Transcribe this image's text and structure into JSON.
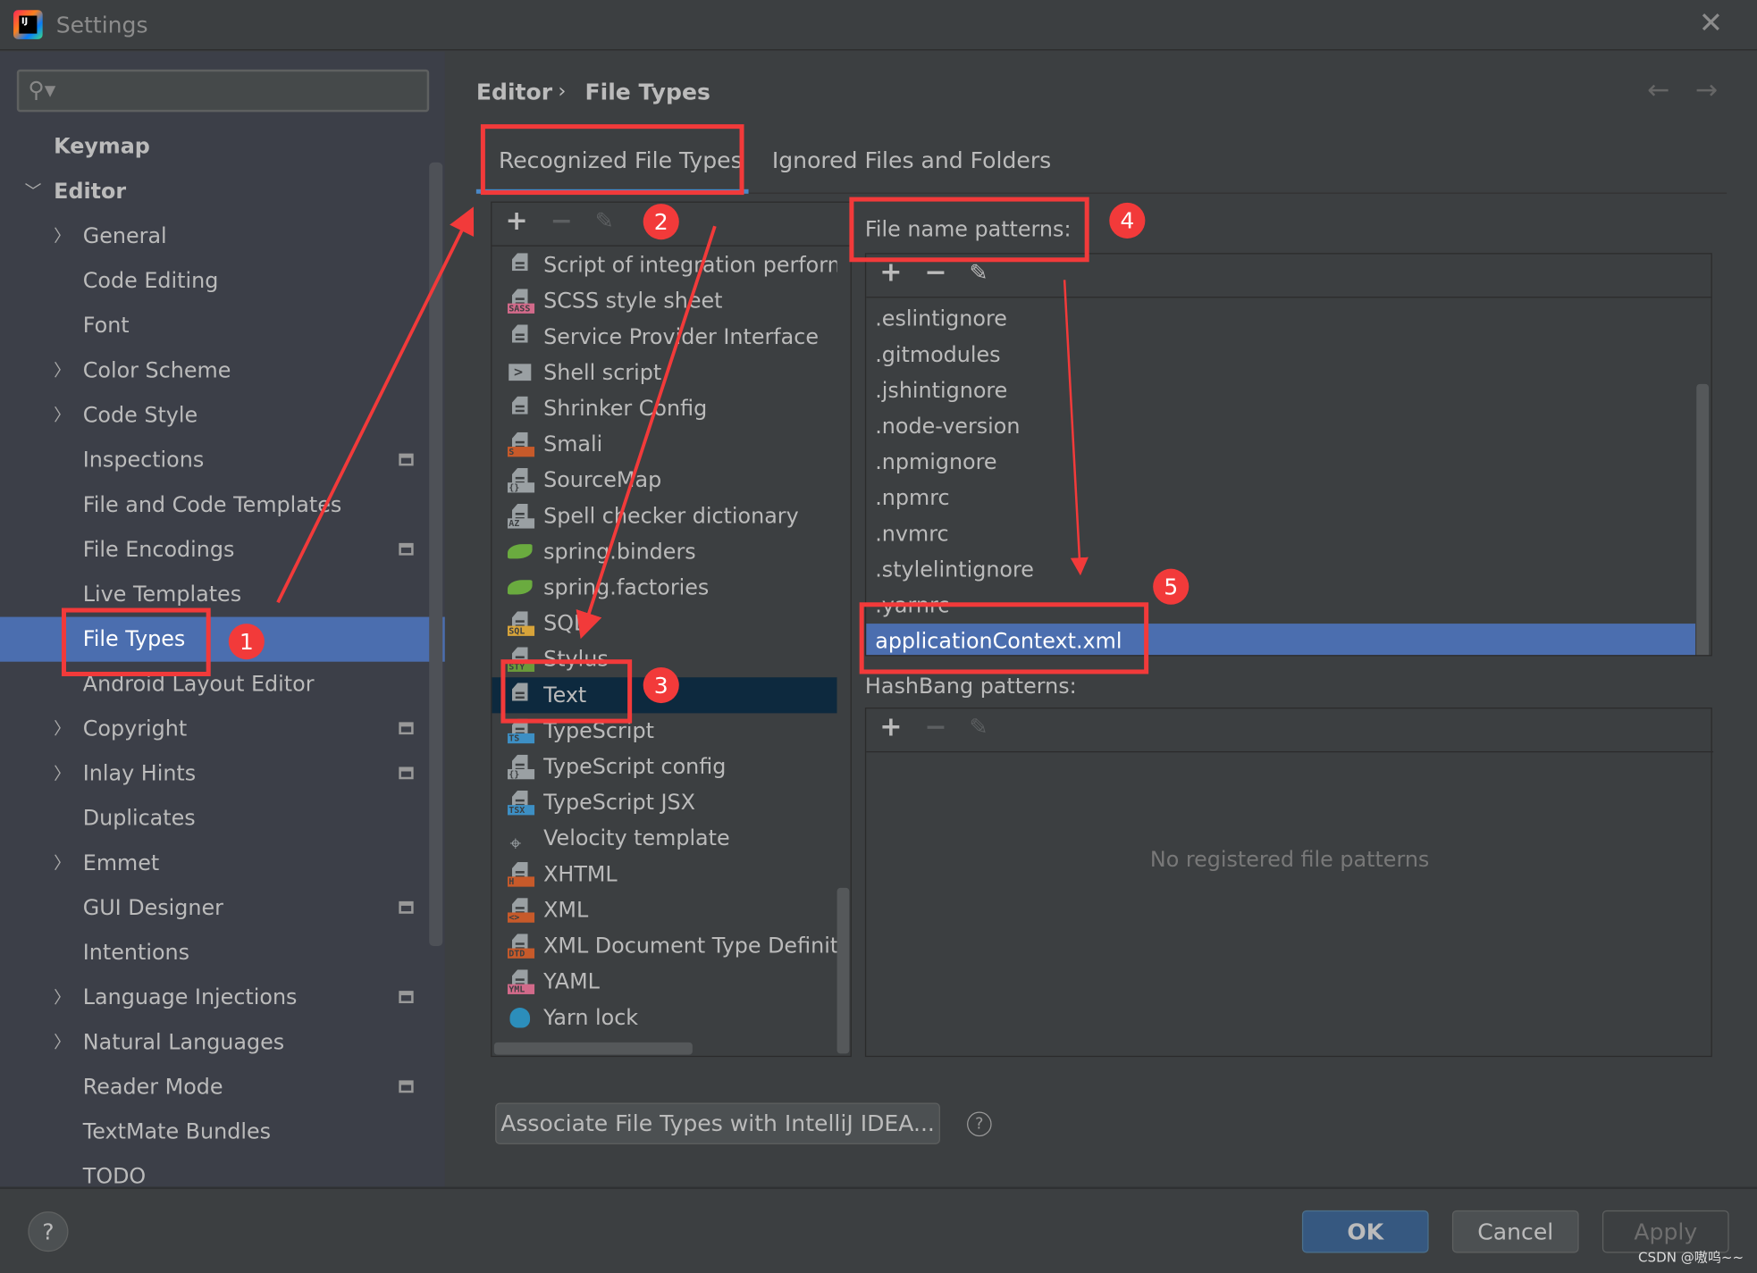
{
  "window": {
    "title": "Settings",
    "close_icon": "close-icon"
  },
  "search": {
    "placeholder": "",
    "icon": "search-icon"
  },
  "sidebar": {
    "items": [
      {
        "label": "Keymap",
        "level": 0,
        "bold": true
      },
      {
        "label": "Editor",
        "level": 0,
        "bold": true,
        "expanded": true
      },
      {
        "label": "General",
        "level": 1,
        "chevron": true
      },
      {
        "label": "Code Editing",
        "level": 1
      },
      {
        "label": "Font",
        "level": 1
      },
      {
        "label": "Color Scheme",
        "level": 1,
        "chevron": true
      },
      {
        "label": "Code Style",
        "level": 1,
        "chevron": true
      },
      {
        "label": "Inspections",
        "level": 1,
        "project": true
      },
      {
        "label": "File and Code Templates",
        "level": 1
      },
      {
        "label": "File Encodings",
        "level": 1,
        "project": true
      },
      {
        "label": "Live Templates",
        "level": 1
      },
      {
        "label": "File Types",
        "level": 1,
        "selected": true
      },
      {
        "label": "Android Layout Editor",
        "level": 1
      },
      {
        "label": "Copyright",
        "level": 1,
        "chevron": true,
        "project": true
      },
      {
        "label": "Inlay Hints",
        "level": 1,
        "chevron": true,
        "project": true
      },
      {
        "label": "Duplicates",
        "level": 1
      },
      {
        "label": "Emmet",
        "level": 1,
        "chevron": true
      },
      {
        "label": "GUI Designer",
        "level": 1,
        "project": true
      },
      {
        "label": "Intentions",
        "level": 1
      },
      {
        "label": "Language Injections",
        "level": 1,
        "chevron": true,
        "project": true
      },
      {
        "label": "Natural Languages",
        "level": 1,
        "chevron": true
      },
      {
        "label": "Reader Mode",
        "level": 1,
        "project": true
      },
      {
        "label": "TextMate Bundles",
        "level": 1
      },
      {
        "label": "TODO",
        "level": 1
      }
    ]
  },
  "breadcrumb": {
    "parent": "Editor",
    "separator": "›",
    "current": "File Types"
  },
  "tabs": [
    {
      "label": "Recognized File Types",
      "active": true
    },
    {
      "label": "Ignored Files and Folders"
    }
  ],
  "file_types": [
    {
      "label": "Script of integration performance",
      "icon": "text-file-icon"
    },
    {
      "label": "SCSS style sheet",
      "icon": "scss-file-icon",
      "badge": "SASS",
      "color": "#d26a8a"
    },
    {
      "label": "Service Provider Interface",
      "icon": "text-file-icon"
    },
    {
      "label": "Shell script",
      "icon": "shell-icon"
    },
    {
      "label": "Shrinker Config",
      "icon": "text-file-icon"
    },
    {
      "label": "Smali",
      "icon": "smali-file-icon",
      "badge": "S",
      "color": "#c75a2a"
    },
    {
      "label": "SourceMap",
      "icon": "sourcemap-file-icon",
      "badge": "{}",
      "color": "#9aa0a3"
    },
    {
      "label": "Spell checker dictionary",
      "icon": "dictionary-file-icon",
      "badge": "AZ",
      "color": "#9aa0a3"
    },
    {
      "label": "spring.binders",
      "icon": "spring-icon",
      "spring": true
    },
    {
      "label": "spring.factories",
      "icon": "spring-icon",
      "spring": true
    },
    {
      "label": "SQL",
      "icon": "sql-file-icon",
      "badge": "SQL",
      "color": "#d8a43a"
    },
    {
      "label": "Stylus",
      "icon": "stylus-file-icon",
      "badge": "STY",
      "color": "#6a9a3a"
    },
    {
      "label": "Text",
      "icon": "text-file-icon",
      "selected": true
    },
    {
      "label": "TypeScript",
      "icon": "typescript-file-icon",
      "badge": "TS",
      "color": "#3d8fc4"
    },
    {
      "label": "TypeScript config",
      "icon": "tsconfig-file-icon",
      "badge": "{}",
      "color": "#9aa0a3"
    },
    {
      "label": "TypeScript JSX",
      "icon": "tsx-file-icon",
      "badge": "TSX",
      "color": "#3d8fc4"
    },
    {
      "label": "Velocity template",
      "icon": "velocity-icon"
    },
    {
      "label": "XHTML",
      "icon": "xhtml-file-icon",
      "badge": "H",
      "color": "#c75a2a"
    },
    {
      "label": "XML",
      "icon": "xml-file-icon",
      "badge": "<>",
      "color": "#c75a2a"
    },
    {
      "label": "XML Document Type Definition",
      "icon": "dtd-file-icon",
      "badge": "DTD",
      "color": "#c75a2a"
    },
    {
      "label": "YAML",
      "icon": "yaml-file-icon",
      "badge": "YML",
      "color": "#d26a8a"
    },
    {
      "label": "Yarn lock",
      "icon": "yarn-icon",
      "yarn": true
    }
  ],
  "patterns": {
    "label": "File name patterns:",
    "items": [
      ".eslintignore",
      ".gitmodules",
      ".jshintignore",
      ".node-version",
      ".npmignore",
      ".npmrc",
      ".nvmrc",
      ".stylelintignore",
      ".yarnrc",
      "applicationContext.xml"
    ],
    "selected": "applicationContext.xml"
  },
  "hashbang": {
    "label": "HashBang patterns:",
    "empty_text": "No registered file patterns"
  },
  "associate_button": "Associate File Types with IntelliJ IDEA...",
  "footer": {
    "ok": "OK",
    "cancel": "Cancel",
    "apply": "Apply",
    "help": "?"
  },
  "annotations": {
    "labels": [
      "1",
      "2",
      "3",
      "4",
      "5"
    ],
    "color": "#f23a3a"
  },
  "watermark": "CSDN @嗷呜~~",
  "colors": {
    "background": "#3c3f41",
    "selection": "#4b6eaf",
    "list_selection": "#0d293e",
    "accent": "#4a88c7"
  }
}
